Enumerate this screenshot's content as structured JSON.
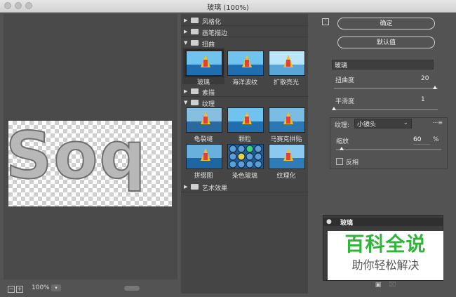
{
  "window": {
    "title": "玻璃 (100%)"
  },
  "preview": {
    "canvas_text": "Soq",
    "zoom": "100%",
    "zoom_out": "−",
    "zoom_in": "+",
    "zoom_caret": "▾"
  },
  "gallery": {
    "arrow_collapsed": "▶",
    "arrow_expanded": "▼",
    "categories": {
      "stylize": "风格化",
      "brush_strokes": "画笔描边",
      "distort": "扭曲",
      "sketch": "素描",
      "texture": "纹理",
      "artistic": "艺术效果"
    },
    "distort_filters": [
      "玻璃",
      "海洋波纹",
      "扩散亮光"
    ],
    "texture_filters": [
      "龟裂缝",
      "颗粒",
      "马赛克拼贴",
      "拼缀图",
      "染色玻璃",
      "纹理化"
    ]
  },
  "controls": {
    "ok": "确定",
    "default": "默认值",
    "filter_select": "玻璃",
    "distortion_label": "扭曲度",
    "distortion_value": "20",
    "distortion_fraction": 0.976,
    "smoothness_label": "平滑度",
    "smoothness_value": "1",
    "smoothness_fraction": 0.0,
    "texture_label": "纹理:",
    "texture_value": "小镜头",
    "scaling_label": "缩放",
    "scaling_value": "60",
    "scaling_unit": "%",
    "scaling_fraction": 0.05,
    "invert_label": "反相",
    "menu_icon": "⋯≡",
    "caret": "⌄"
  },
  "layers": {
    "active": "玻璃",
    "eye": "●"
  },
  "watermark": {
    "line1": "百科全说",
    "line2": "助你轻松解决"
  },
  "icons": {
    "new_layer": "new-effect-layer-icon",
    "delete": "trash-icon"
  }
}
